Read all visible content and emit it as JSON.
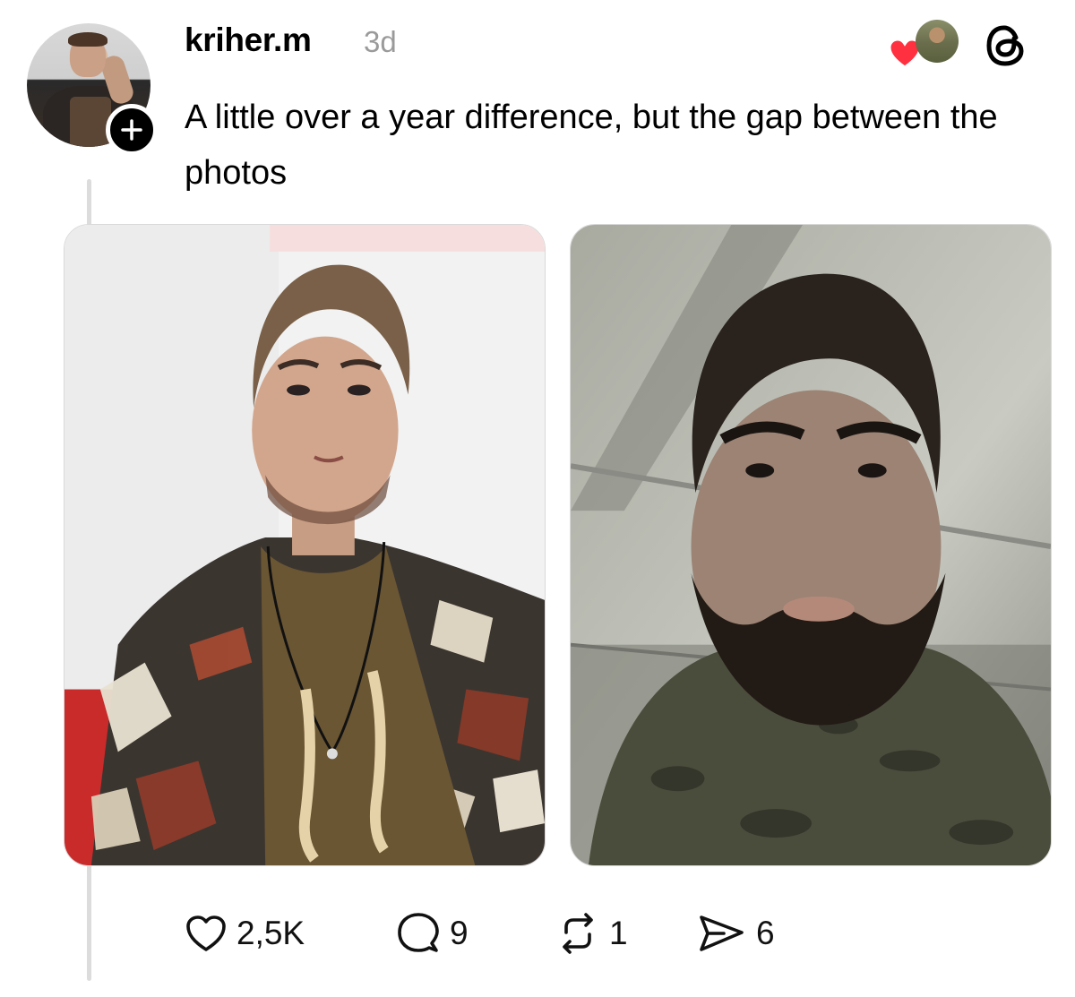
{
  "post": {
    "username": "kriher.m",
    "time": "3d",
    "text": "A little over a year difference, but the gap between the photos"
  },
  "actions": {
    "likes": "2,5K",
    "replies": "9",
    "reposts": "1",
    "shares": "6"
  },
  "icons": [
    "follow-plus-icon",
    "heart-icon",
    "threads-logo-icon",
    "like-heart-icon",
    "reply-bubble-icon",
    "repost-icon",
    "share-send-icon"
  ],
  "colors": {
    "heart": "#ff3040",
    "muted": "#9a9a9a",
    "thread_line": "#dcdcdc"
  }
}
